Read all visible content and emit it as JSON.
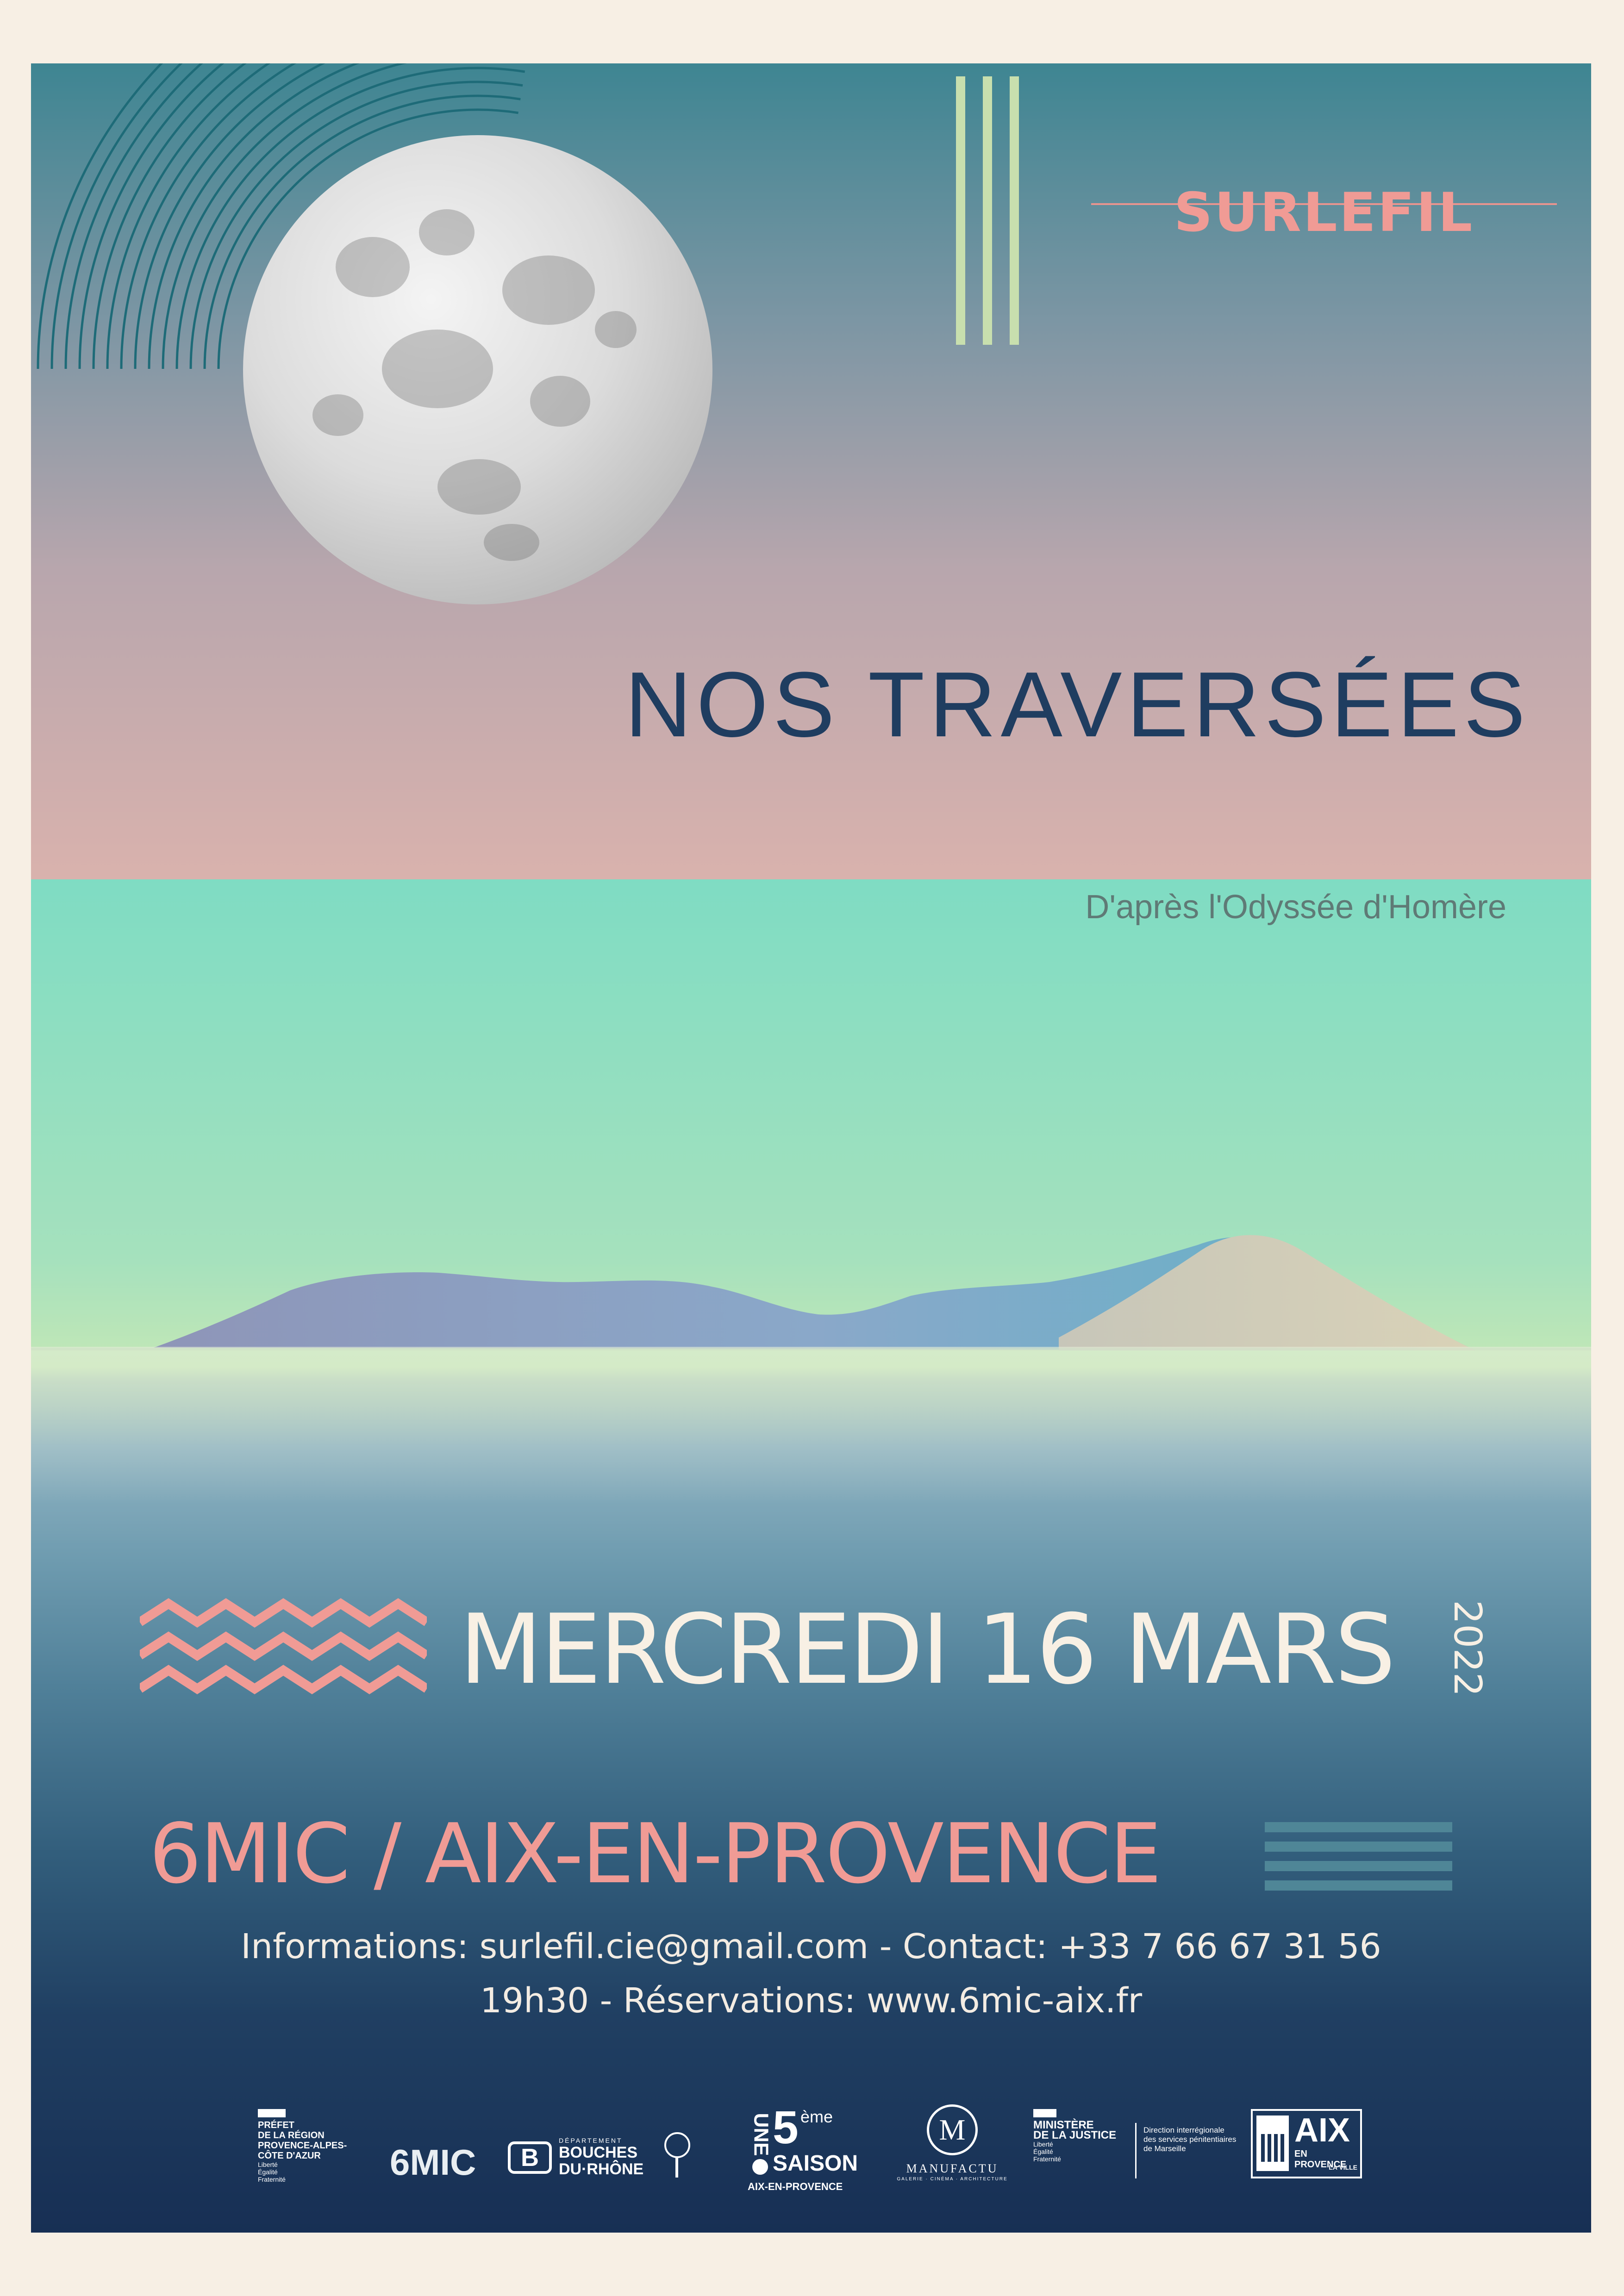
{
  "brand": "SURLEFIL",
  "title": "NOS TRAVERSÉES",
  "subtitle": "D'après l'Odyssée d'Homère",
  "date": "MERCREDI 16 MARS",
  "year": "2022",
  "venue": "6MIC / AIX-EN-PROVENCE",
  "info": {
    "line1": "Informations: surlefil.cie@gmail.com - Contact: +33 7 66 67 31 56",
    "line2": "19h30 - Réservations: www.6mic-aix.fr"
  },
  "sponsors": {
    "prefet": [
      "PRÉFET",
      "DE LA RÉGION",
      "PROVENCE-ALPES-",
      "CÔTE D'AZUR"
    ],
    "prefet_motto": [
      "Liberté",
      "Égalité",
      "Fraternité"
    ],
    "sixmic": "6MIC",
    "departement": [
      "DÉPARTEMENT",
      "BOUCHES",
      "DU·RHÔNE"
    ],
    "saison": {
      "une": "UNE",
      "num": "5",
      "sup": "ème",
      "saison": "SAISON",
      "city": "AIX-EN-PROVENCE"
    },
    "manufacture": "MANUFACTU",
    "manufacture_sub": "GALERIE · CINÉMA · ARCHITECTURE",
    "justice": [
      "MINISTÈRE",
      "DE LA JUSTICE"
    ],
    "justice_motto": [
      "Liberté",
      "Égalité",
      "Fraternité"
    ],
    "direction": [
      "Direction interrégionale",
      "des services pénitentiaires",
      "de Marseille"
    ],
    "aix": {
      "big": "AIX",
      "sub": "EN PROVENCE",
      "tag": "LA VILLE"
    }
  },
  "colors": {
    "accent_pink": "#f09b95",
    "navy": "#1f3d60",
    "cream": "#f8f0e4",
    "mint_stripe": "#c8dfae",
    "teal_stripe": "#4f8697"
  },
  "icons": [
    "moon-illustration",
    "arc-lines-decoration",
    "zigzag-decoration",
    "horizontal-stripes-decoration",
    "vertical-stripes-decoration"
  ]
}
